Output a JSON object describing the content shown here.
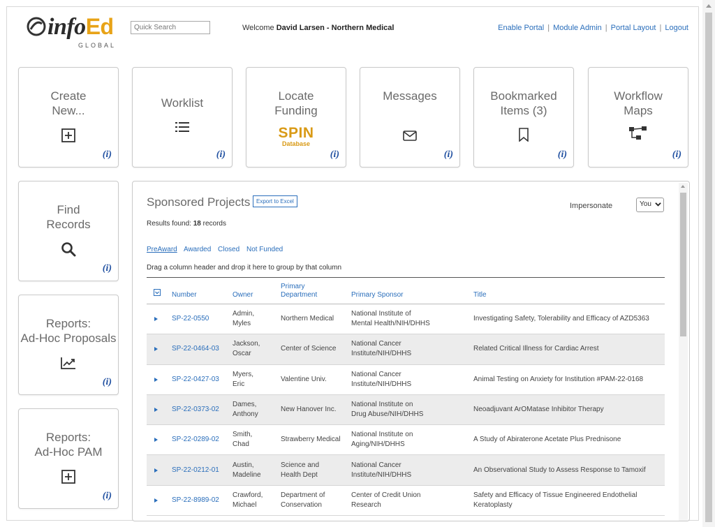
{
  "header": {
    "logo_text": "info",
    "logo_text_accent": "Ed",
    "logo_subtext": "GLOBAL",
    "search_placeholder": "Quick Search",
    "welcome_prefix": "Welcome",
    "welcome_user": "David Larsen - Northern Medical",
    "links": [
      "Enable Portal",
      "Module Admin",
      "Portal Layout",
      "Logout"
    ]
  },
  "tiles": {
    "create": {
      "label": "Create\nNew...",
      "icon": "plus-square-icon",
      "info": "(i)"
    },
    "worklist": {
      "label": "Worklist",
      "icon": "list-icon",
      "info": "(i)"
    },
    "locate": {
      "label": "Locate\nFunding",
      "logo": "SPIN",
      "logo_sub": "Database",
      "info": "(i)"
    },
    "messages": {
      "label": "Messages",
      "icon": "envelope-icon",
      "info": "(i)"
    },
    "bookmarked": {
      "label": "Bookmarked\nItems (3)",
      "icon": "bookmark-icon",
      "info": "(i)"
    },
    "workflow": {
      "label": "Workflow\nMaps",
      "icon": "workflow-icon",
      "info": "(i)"
    },
    "find": {
      "label": "Find\nRecords",
      "icon": "search-icon",
      "info": "(i)"
    },
    "reports_adhoc": {
      "label": "Reports:\nAd-Hoc Proposals",
      "icon": "chart-icon",
      "info": "(i)"
    },
    "reports_pam": {
      "label": "Reports:\nAd-Hoc PAM",
      "icon": "plus-square-icon",
      "info": "(i)"
    }
  },
  "panel": {
    "title": "Sponsored Projects",
    "export_label": "Export to Excel",
    "results_prefix": "Results found:",
    "results_count": "18",
    "results_suffix": "records",
    "impersonate_label": "Impersonate",
    "impersonate_value": "You",
    "tabs": [
      "PreAward",
      "Awarded",
      "Closed",
      "Not Funded"
    ],
    "group_hint": "Drag a column header and drop it here to group by that column",
    "columns": {
      "number": "Number",
      "owner": "Owner",
      "department": "Primary\nDepartment",
      "sponsor": "Primary Sponsor",
      "title": "Title"
    },
    "rows": [
      {
        "number": "SP-22-0550",
        "owner": "Admin,\nMyles",
        "department": "Northern Medical",
        "sponsor": "National Institute of\nMental Health/NIH/DHHS",
        "title": "Investigating Safety, Tolerability and Efficacy of AZD5363"
      },
      {
        "number": "SP-22-0464-03",
        "owner": "Jackson,\nOscar",
        "department": "Center of Science",
        "sponsor": "National Cancer\nInstitute/NIH/DHHS",
        "title": "Related Critical Illness for Cardiac Arrest"
      },
      {
        "number": "SP-22-0427-03",
        "owner": "Myers,\nEric",
        "department": "Valentine Univ.",
        "sponsor": "National Cancer\nInstitute/NIH/DHHS",
        "title": "Animal Testing on Anxiety for Institution #PAM-22-0168"
      },
      {
        "number": "SP-22-0373-02",
        "owner": "Dames,\nAnthony",
        "department": "New Hanover Inc.",
        "sponsor": "National Institute on\nDrug Abuse/NIH/DHHS",
        "title": "Neoadjuvant ArOMatase Inhibitor Therapy"
      },
      {
        "number": "SP-22-0289-02",
        "owner": "Smith,\nChad",
        "department": "Strawberry Medical",
        "sponsor": "National Institute on\nAging/NIH/DHHS",
        "title": "A Study of Abiraterone Acetate Plus Prednisone"
      },
      {
        "number": "SP-22-0212-01",
        "owner": "Austin,\nMadeline",
        "department": "Science and\nHealth Dept",
        "sponsor": "National Cancer\nInstitute/NIH/DHHS",
        "title": "An Observational Study to Assess Response to Tamoxif"
      },
      {
        "number": "SP-22-8989-02",
        "owner": "Crawford,\nMichael",
        "department": "Department of\nConservation",
        "sponsor": "Center of Credit Union\nResearch",
        "title": "Safety and Efficacy of Tissue Engineered Endothelial\nKeratoplasty"
      }
    ]
  }
}
